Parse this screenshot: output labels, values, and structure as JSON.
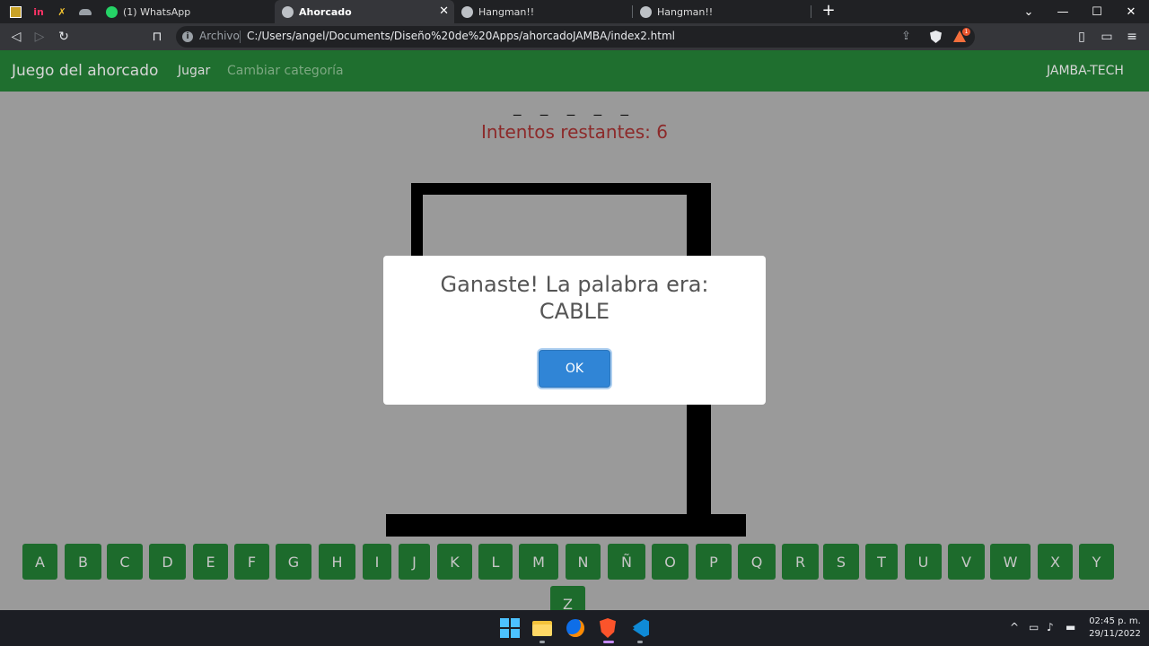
{
  "browser": {
    "tabs": [
      {
        "label": "(1) WhatsApp",
        "favicon": "whatsapp-icon"
      },
      {
        "label": "Ahorcado",
        "favicon": "globe-icon",
        "active": true
      },
      {
        "label": "Hangman!!",
        "favicon": "globe-icon"
      },
      {
        "label": "Hangman!!",
        "favicon": "globe-icon"
      }
    ],
    "scheme_label": "Archivo",
    "url": "C:/Users/angel/Documents/Diseño%20de%20Apps/ahorcadoJAMBA/index2.html",
    "rewards_badge": "1"
  },
  "navbar": {
    "brand": "Juego del ahorcado",
    "links": [
      "Jugar",
      "Cambiar categoría"
    ],
    "right": "JAMBA-TECH"
  },
  "game": {
    "word_blanks": "_ _ _ _ _",
    "attempts_label": "Intentos restantes: 6",
    "letters": [
      "A",
      "B",
      "C",
      "D",
      "E",
      "F",
      "G",
      "H",
      "I",
      "J",
      "K",
      "L",
      "M",
      "N",
      "Ñ",
      "O",
      "P",
      "Q",
      "R",
      "S",
      "T",
      "U",
      "V",
      "W",
      "X",
      "Y",
      "Z"
    ]
  },
  "modal": {
    "title_line1": "Ganaste! La palabra era:",
    "title_line2": "CABLE",
    "ok_label": "OK"
  },
  "taskbar": {
    "apps": [
      "windows-start-icon",
      "file-explorer-icon",
      "firefox-icon",
      "brave-icon",
      "vscode-icon"
    ],
    "time": "02:45 p. m.",
    "date": "29/11/2022"
  },
  "colors": {
    "navbar": "#1f6f2f",
    "key": "#1d6b2c",
    "attempts": "#8c2a2a",
    "ok_button": "#3085d6"
  }
}
